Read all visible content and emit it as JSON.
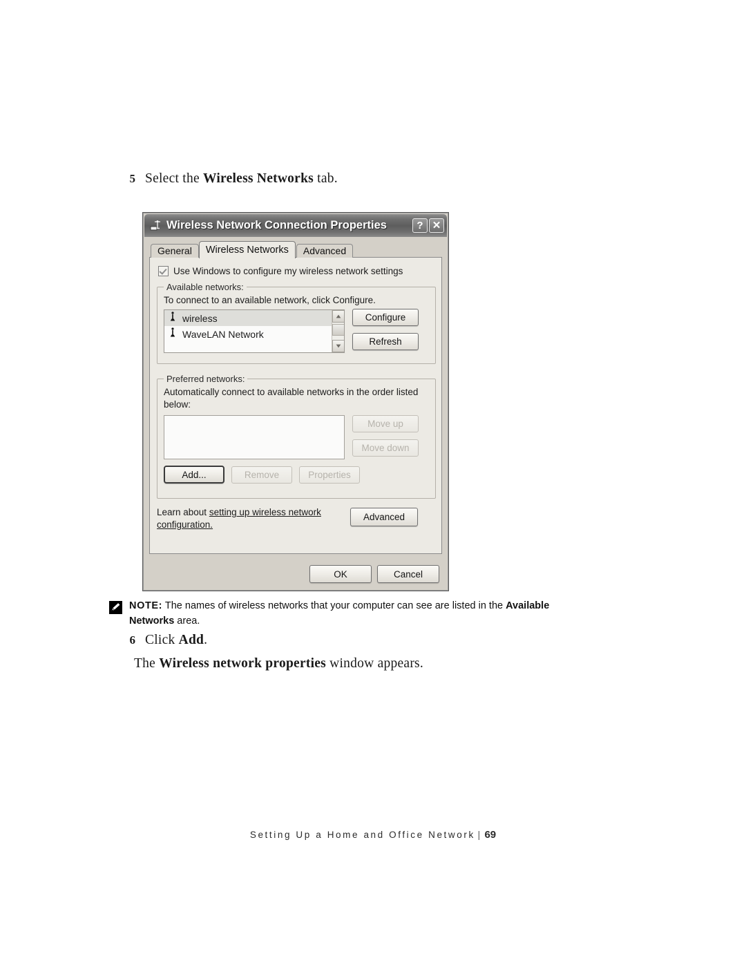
{
  "page": {
    "steps": [
      {
        "num": "5",
        "parts": [
          {
            "t": "Select the ",
            "b": false
          },
          {
            "t": "Wireless Networks",
            "b": true
          },
          {
            "t": " tab.",
            "b": false
          }
        ]
      },
      {
        "num": "6",
        "parts": [
          {
            "t": "Click ",
            "b": false
          },
          {
            "t": "Add",
            "b": true
          },
          {
            "t": ".",
            "b": false
          }
        ]
      }
    ],
    "step5_line": "Select the Wireless Networks tab.",
    "step6_line": "Click Add.",
    "result_line": "The Wireless network properties window appears.",
    "result_prefix": "The ",
    "result_bold": "Wireless network properties",
    "result_suffix": " window appears."
  },
  "note": {
    "icon": "note-pencil-icon",
    "label": "NOTE:",
    "text_before": " The names of wireless networks that your computer can see are listed in the ",
    "bold_1": "Available Networks",
    "text_after": " area."
  },
  "footer": {
    "title": "Setting Up a Home and Office Network",
    "separator": "|",
    "page_number": "69"
  },
  "dialog": {
    "title": "Wireless Network Connection Properties",
    "title_icon": "network-adapter-icon",
    "help_button": "?",
    "close_button": "✕",
    "tabs": [
      {
        "label": "General",
        "active": false
      },
      {
        "label": "Wireless Networks",
        "active": true
      },
      {
        "label": "Advanced",
        "active": false
      }
    ],
    "use_windows_checkbox": {
      "label": "Use Windows to configure my wireless network settings",
      "checked": true
    },
    "available_networks": {
      "group_label": "Available networks:",
      "help_text": "To connect to an available network, click Configure.",
      "items": [
        {
          "name": "wireless",
          "icon": "wireless-network-icon",
          "selected": true
        },
        {
          "name": "WaveLAN Network",
          "icon": "wireless-network-icon",
          "selected": false
        }
      ],
      "configure_button": "Configure",
      "refresh_button": "Refresh"
    },
    "preferred_networks": {
      "group_label": "Preferred networks:",
      "help_text": "Automatically connect to available networks in the order listed below:",
      "items": [],
      "move_up_button": "Move up",
      "move_down_button": "Move down",
      "add_button": "Add...",
      "remove_button": "Remove",
      "properties_button": "Properties"
    },
    "learn_more": {
      "prefix": "Learn about ",
      "link": "setting up wireless network configuration.",
      "advanced_button": "Advanced"
    },
    "ok_button": "OK",
    "cancel_button": "Cancel"
  },
  "colors": {
    "dialog_face": "#d4d0c8",
    "tab_panel": "#eceae4",
    "titlebar_dark": "#5d5d5d",
    "selection": "#dededa"
  }
}
